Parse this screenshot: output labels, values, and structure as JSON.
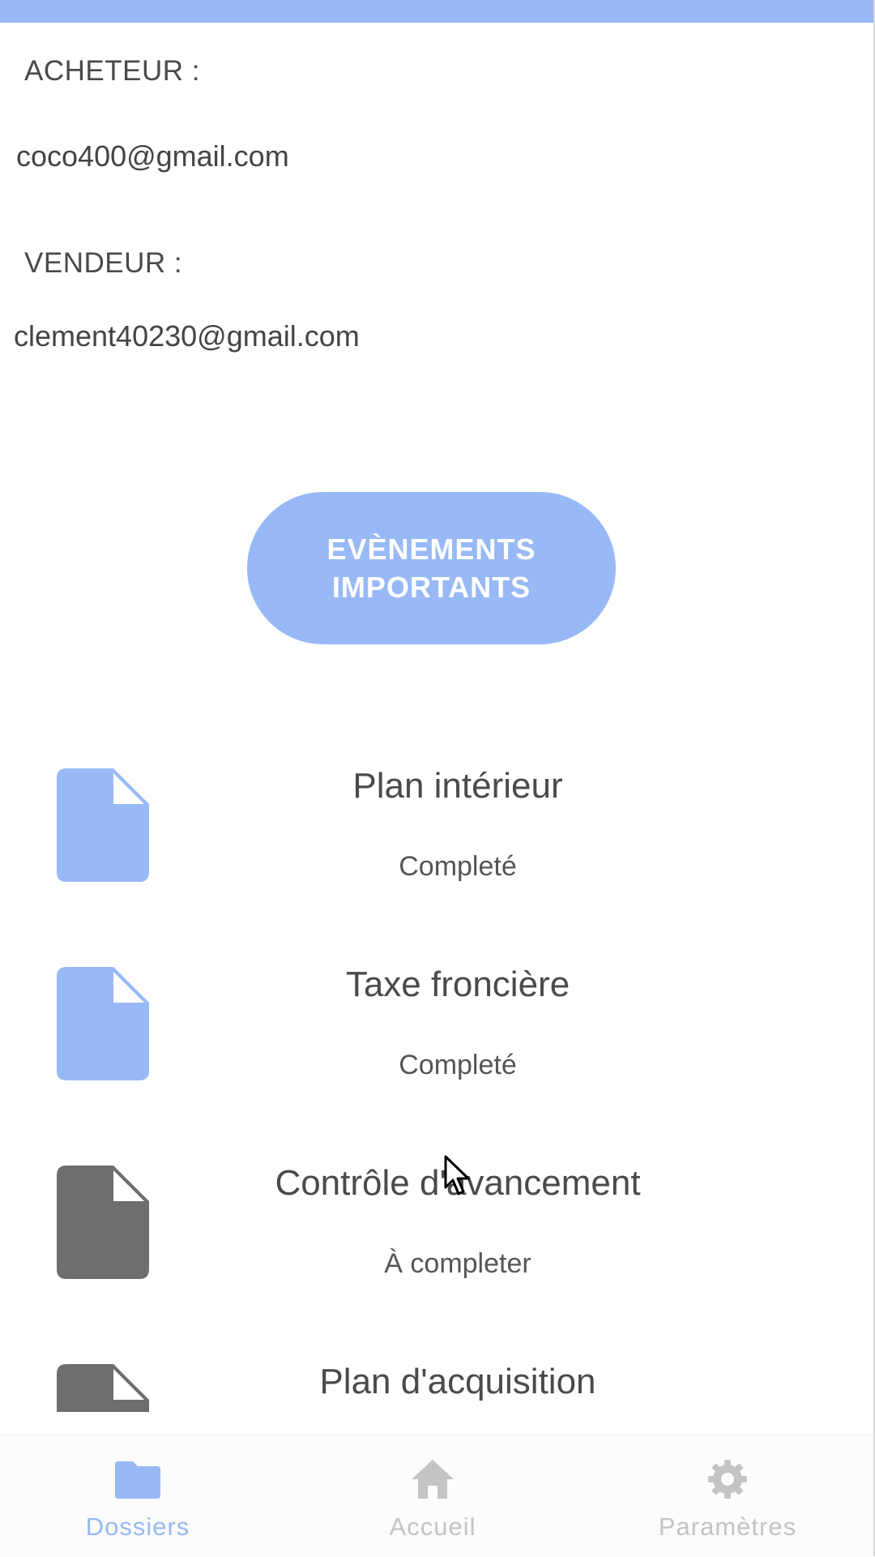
{
  "buyer": {
    "label": "ACHETEUR :",
    "email": "coco400@gmail.com"
  },
  "seller": {
    "label": "VENDEUR :",
    "email": "clement40230@gmail.com"
  },
  "events_button": {
    "label": "EVÈNEMENTS IMPORTANTS"
  },
  "documents": [
    {
      "title": "Plan intérieur",
      "status": "Completé",
      "icon": "document-icon",
      "color": "#98b9f6"
    },
    {
      "title": "Taxe froncière",
      "status": "Completé",
      "icon": "document-icon",
      "color": "#98b9f6"
    },
    {
      "title": "Contrôle d'avancement",
      "status": "À completer",
      "icon": "document-icon",
      "color": "#6e6e6e"
    },
    {
      "title": "Plan d'acquisition",
      "status": "",
      "icon": "document-icon",
      "color": "#6e6e6e"
    }
  ],
  "nav": {
    "items": [
      {
        "label": "Dossiers",
        "icon": "folder-icon",
        "active": true
      },
      {
        "label": "Accueil",
        "icon": "home-icon",
        "active": false
      },
      {
        "label": "Paramètres",
        "icon": "gear-icon",
        "active": false
      }
    ]
  },
  "colors": {
    "accent": "#98b9f6",
    "inactive": "#c4c4c4",
    "pending_doc": "#6e6e6e"
  }
}
